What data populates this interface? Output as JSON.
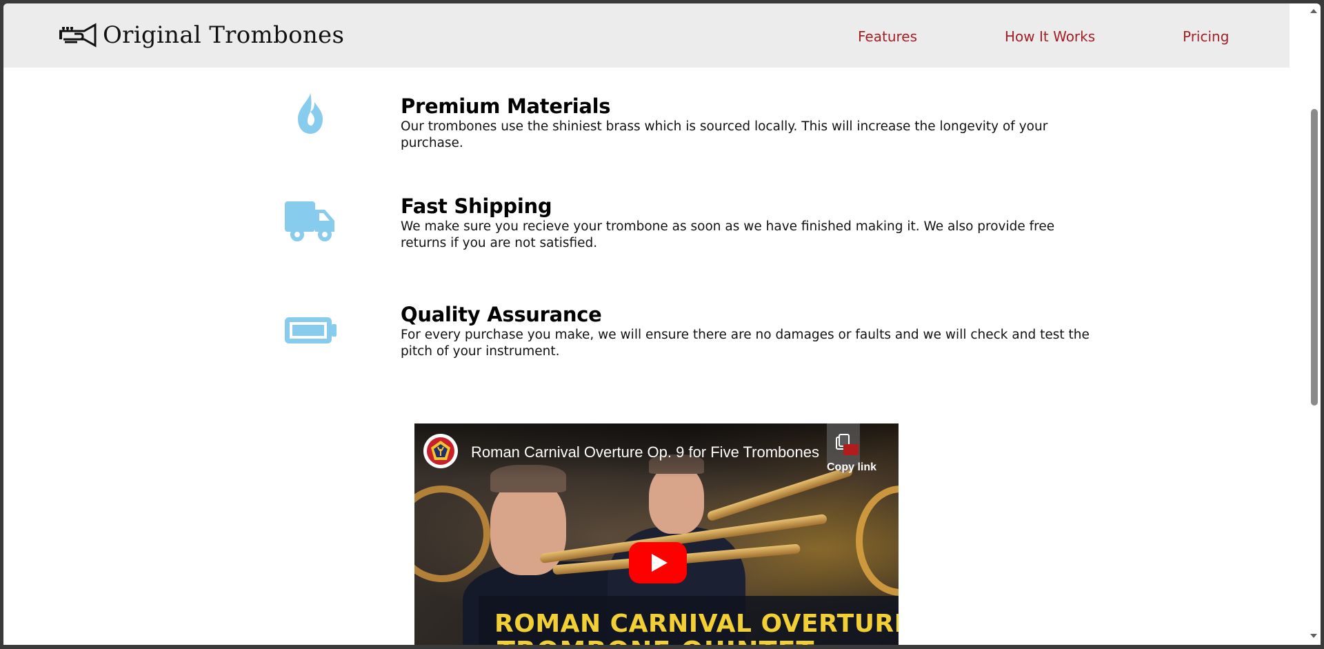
{
  "header": {
    "brand": "Original Trombones",
    "logo_icon": "trumpet-icon",
    "nav": [
      {
        "label": "Features"
      },
      {
        "label": "How It Works"
      },
      {
        "label": "Pricing"
      }
    ],
    "nav_color": "#a31f24",
    "background": "#ececed"
  },
  "features": [
    {
      "icon": "flame-icon",
      "title": "Premium Materials",
      "description": "Our trombones use the shiniest brass which is sourced locally. This will increase the longevity of your purchase."
    },
    {
      "icon": "truck-icon",
      "title": "Fast Shipping",
      "description": "We make sure you recieve your trombone as soon as we have finished making it. We also provide free returns if you are not satisfied."
    },
    {
      "icon": "battery-icon",
      "title": "Quality Assurance",
      "description": "For every purchase you make, we will ensure there are no damages or faults and we will check and test the pitch of your instrument."
    }
  ],
  "icon_color": "#87ccec",
  "video": {
    "title": "Roman Carnival Overture Op. 9 for Five Trombones",
    "copy_link_label": "Copy link",
    "banner_line1": "ROMAN CARNIVAL OVERTURE",
    "banner_line2": "TROMBONE QUINTET",
    "play_color": "#ff0000",
    "banner_color": "#f2cf35"
  },
  "scrollbar": {
    "position_fraction": 0.2
  }
}
